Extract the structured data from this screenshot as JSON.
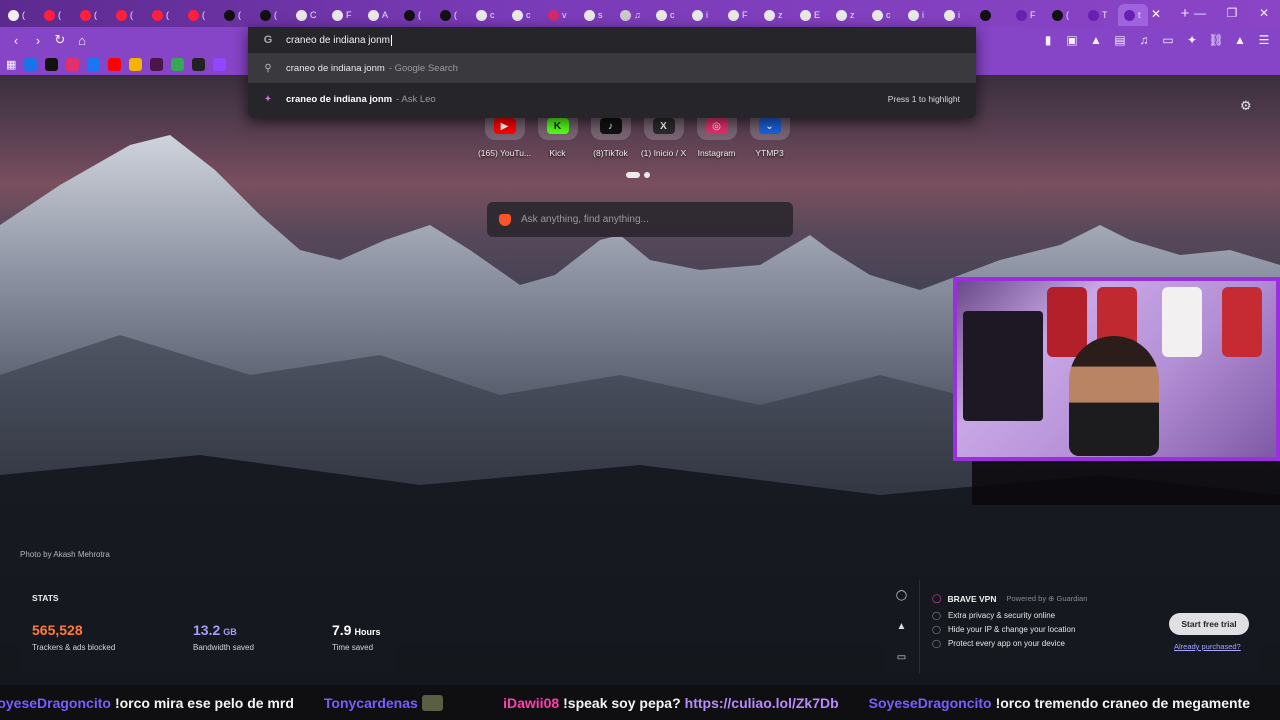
{
  "tabs": [
    {
      "label": "(",
      "color": "#f0f0f0"
    },
    {
      "label": "(",
      "color": "#ff1f3a"
    },
    {
      "label": "(",
      "color": "#ff1f3a"
    },
    {
      "label": "(",
      "color": "#ff1f3a"
    },
    {
      "label": "(",
      "color": "#ff1f3a"
    },
    {
      "label": "(",
      "color": "#ff1f3a"
    },
    {
      "label": "(",
      "color": "#111111"
    },
    {
      "label": "(",
      "color": "#111111"
    },
    {
      "label": "C",
      "color": "#e8e8e8"
    },
    {
      "label": "F",
      "color": "#e8e8e8"
    },
    {
      "label": "A",
      "color": "#e8e8e8"
    },
    {
      "label": "(",
      "color": "#111111"
    },
    {
      "label": "(",
      "color": "#111111"
    },
    {
      "label": "c",
      "color": "#e8e8e8"
    },
    {
      "label": "c",
      "color": "#e8e8e8"
    },
    {
      "label": "v",
      "color": "#d02a6a"
    },
    {
      "label": "s",
      "color": "#e8e8e8"
    },
    {
      "label": "♫",
      "color": "#c9c9c9"
    },
    {
      "label": "c",
      "color": "#e8e8e8"
    },
    {
      "label": "i",
      "color": "#e8e8e8"
    },
    {
      "label": "F",
      "color": "#e8e8e8"
    },
    {
      "label": "z",
      "color": "#e8e8e8"
    },
    {
      "label": "E",
      "color": "#e8e8e8"
    },
    {
      "label": "z",
      "color": "#e8e8e8"
    },
    {
      "label": "c",
      "color": "#e8e8e8"
    },
    {
      "label": "i",
      "color": "#e8e8e8"
    },
    {
      "label": "i",
      "color": "#e8e8e8"
    },
    {
      "label": "",
      "color": "#111111"
    },
    {
      "label": "F",
      "color": "#6a1fb0"
    },
    {
      "label": "(",
      "color": "#111111"
    },
    {
      "label": "T",
      "color": "#6a1fb0"
    }
  ],
  "active_tab": {
    "label": "t",
    "color": "#6a1fb0"
  },
  "omnibox": {
    "query": "craneo de indiana jonm",
    "suggestions": [
      {
        "text": "craneo de indiana jonm",
        "suffix": "- Google Search"
      },
      {
        "text": "craneo de indiana jonm",
        "suffix": "- Ask Leo"
      }
    ],
    "hint": "Press 1 to highlight"
  },
  "top_sites": [
    {
      "label": "(165) YouTu...",
      "logo": "▶",
      "bg": "#ff0000",
      "fg": "#ffffff"
    },
    {
      "label": "Kick",
      "logo": "K",
      "bg": "#53fc18",
      "fg": "#111111"
    },
    {
      "label": "(8)TikTok",
      "logo": "♪",
      "bg": "#111111",
      "fg": "#ffffff"
    },
    {
      "label": "(1) Inicio / X",
      "logo": "X",
      "bg": "#2a2a2a",
      "fg": "#ffffff"
    },
    {
      "label": "Instagram",
      "logo": "◎",
      "bg": "#e1306c",
      "fg": "#ffffff"
    },
    {
      "label": "YTMP3",
      "logo": "⌄",
      "bg": "#1a5fd6",
      "fg": "#ffffff"
    }
  ],
  "search": {
    "placeholder": "Ask anything, find anything..."
  },
  "photo_credit": "Photo by Akash Mehrotra",
  "stats": {
    "title": "STATS",
    "items": [
      {
        "value": "565,528",
        "unit": "",
        "label": "Trackers & ads blocked",
        "color": "#ff7a3d"
      },
      {
        "value": "13.2",
        "unit": "GB",
        "label": "Bandwidth saved",
        "color": "#a79df5"
      },
      {
        "value": "7.9",
        "unit": "Hours",
        "label": "Time saved",
        "color": "#ffffff"
      }
    ]
  },
  "vpn": {
    "title": "BRAVE VPN",
    "powered": "Powered by ⊕ Guardian",
    "features": [
      "Extra privacy & security online",
      "Hide your IP & change your location",
      "Protect every app on your device"
    ],
    "cta": "Start free trial",
    "link": "Already purchased?"
  },
  "ticker": [
    {
      "user": "SoyeseDragoncito",
      "msg": "!orco mira ese pelo de mrd",
      "color": "#7b5cff"
    },
    {
      "user": "Tonycardenas",
      "msg": "",
      "color": "#7b5cff",
      "emote": true
    },
    {
      "user": "iDawii08",
      "msg": "!speak soy pepa?",
      "color": "#ff3fb0",
      "link": "https://culiao.lol/Zk7Db"
    },
    {
      "user": "SoyeseDragoncito",
      "msg": "!orco tremendo craneo de megamente",
      "color": "#7b5cff"
    }
  ]
}
